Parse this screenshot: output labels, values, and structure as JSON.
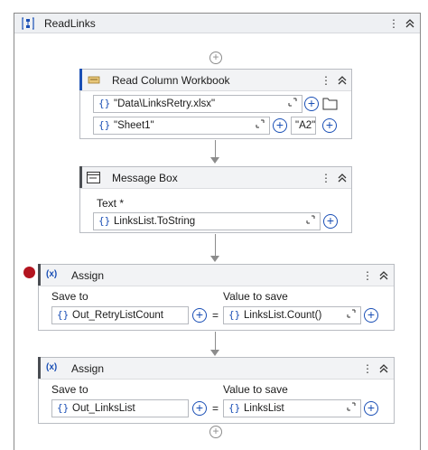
{
  "sequence": {
    "title": "ReadLinks"
  },
  "read_column": {
    "title": "Read Column Workbook",
    "path_value": "\"Data\\LinksRetry.xlsx\"",
    "sheet_value": "\"Sheet1\"",
    "cell_value": "\"A2\""
  },
  "message_box": {
    "title": "Message Box",
    "text_label": "Text *",
    "text_value": "LinksList.ToString"
  },
  "assign1": {
    "title": "Assign",
    "save_to_label": "Save to",
    "value_label": "Value to save",
    "save_to_value": "Out_RetryListCount",
    "value_value": "LinksList.Count()",
    "eq": "="
  },
  "assign2": {
    "title": "Assign",
    "save_to_label": "Save to",
    "value_label": "Value to save",
    "save_to_value": "Out_LinksList",
    "value_value": "LinksList",
    "eq": "="
  },
  "icons": {
    "sequence": "sequence-icon",
    "excel": "excel-read-icon",
    "message": "message-box-icon",
    "assign": "assign-icon",
    "more": "more-vert-icon",
    "collapse": "collapse-icon",
    "folder": "folder-icon"
  },
  "colors": {
    "accent": "#1a4fb5",
    "breakpoint": "#b3141f"
  }
}
